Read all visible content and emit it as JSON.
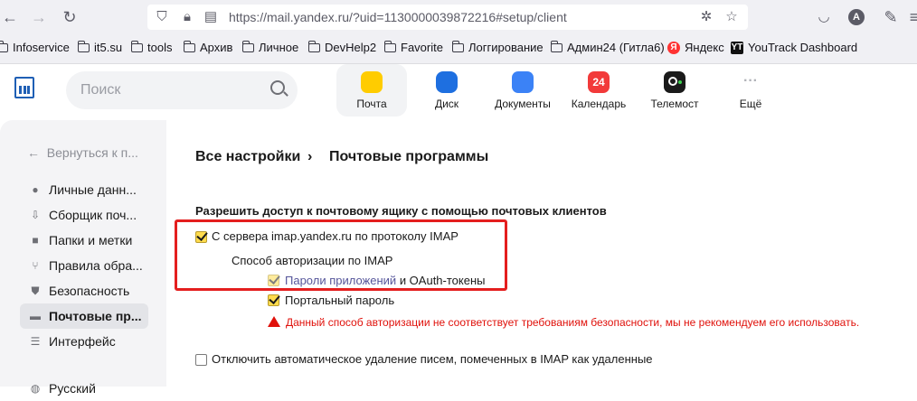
{
  "browser": {
    "url": "https://mail.yandex.ru/?uid=1130000039872216#setup/client",
    "avatar_letter": "A"
  },
  "bookmarks": [
    {
      "label": "Infoservice",
      "icon": "folder-icon"
    },
    {
      "label": "it5.su",
      "icon": "folder-icon"
    },
    {
      "label": "tools",
      "icon": "folder-icon"
    },
    {
      "label": "Архив",
      "icon": "folder-icon"
    },
    {
      "label": "Личное",
      "icon": "folder-icon"
    },
    {
      "label": "DevHelp2",
      "icon": "folder-icon"
    },
    {
      "label": "Favorite",
      "icon": "folder-icon"
    },
    {
      "label": "Логгирование",
      "icon": "folder-icon"
    },
    {
      "label": "Админ24 (Гитла6)",
      "icon": "folder-icon"
    },
    {
      "label": "Яндекс",
      "icon": "yandex-favicon"
    },
    {
      "label": "YouTrack Dashboard",
      "icon": "youtrack-favicon"
    }
  ],
  "header": {
    "search_placeholder": "Поиск",
    "services": [
      {
        "label": "Почта",
        "icon": "mail-icon",
        "color": "#ffcc00"
      },
      {
        "label": "Диск",
        "icon": "disk-icon",
        "color": "#1e6fe0"
      },
      {
        "label": "Документы",
        "icon": "documents-icon",
        "color": "#3b82f6"
      },
      {
        "label": "Календарь",
        "icon": "calendar-icon",
        "color": "#f23a3a",
        "badge": "24"
      },
      {
        "label": "Телемост",
        "icon": "telemost-icon",
        "color": "#1a1a1a"
      },
      {
        "label": "Ещё",
        "icon": "more-icon",
        "color": "#b0b2b8"
      }
    ]
  },
  "sidebar": {
    "back_label": "Вернуться к п...",
    "items": [
      {
        "label": "Личные данн...",
        "icon": "person-icon"
      },
      {
        "label": "Сборщик поч...",
        "icon": "collector-icon"
      },
      {
        "label": "Папки и метки",
        "icon": "folder-icon"
      },
      {
        "label": "Правила обра...",
        "icon": "rules-icon"
      },
      {
        "label": "Безопасность",
        "icon": "shield-icon"
      },
      {
        "label": "Почтовые пр...",
        "icon": "mail-clients-icon"
      },
      {
        "label": "Интерфейс",
        "icon": "sliders-icon"
      },
      {
        "label": "Русский",
        "icon": "language-icon"
      }
    ]
  },
  "main": {
    "breadcrumb": {
      "root": "Все настройки",
      "separator": "›",
      "current": "Почтовые программы"
    },
    "section_title": "Разрешить доступ к почтовому ящику с помощью почтовых клиентов",
    "imap_label": "С сервера imap.yandex.ru по протоколу IMAP",
    "auth_title": "Способ авторизации по IMAP",
    "app_passwords_link": "Пароли приложений",
    "oauth_suffix": "и OAuth-токены",
    "portal_password": "Портальный пароль",
    "warning": "Данный способ авторизации не соответствует требованиям безопасности, мы не рекомендуем его использовать.",
    "auto_delete_label": "Отключить автоматическое удаление писем, помеченных в IMAP как удаленные"
  },
  "colors": {
    "highlight_box": "#e41e1e",
    "warning": "#e0110b",
    "checkbox_checked": "#ffdb4d"
  }
}
